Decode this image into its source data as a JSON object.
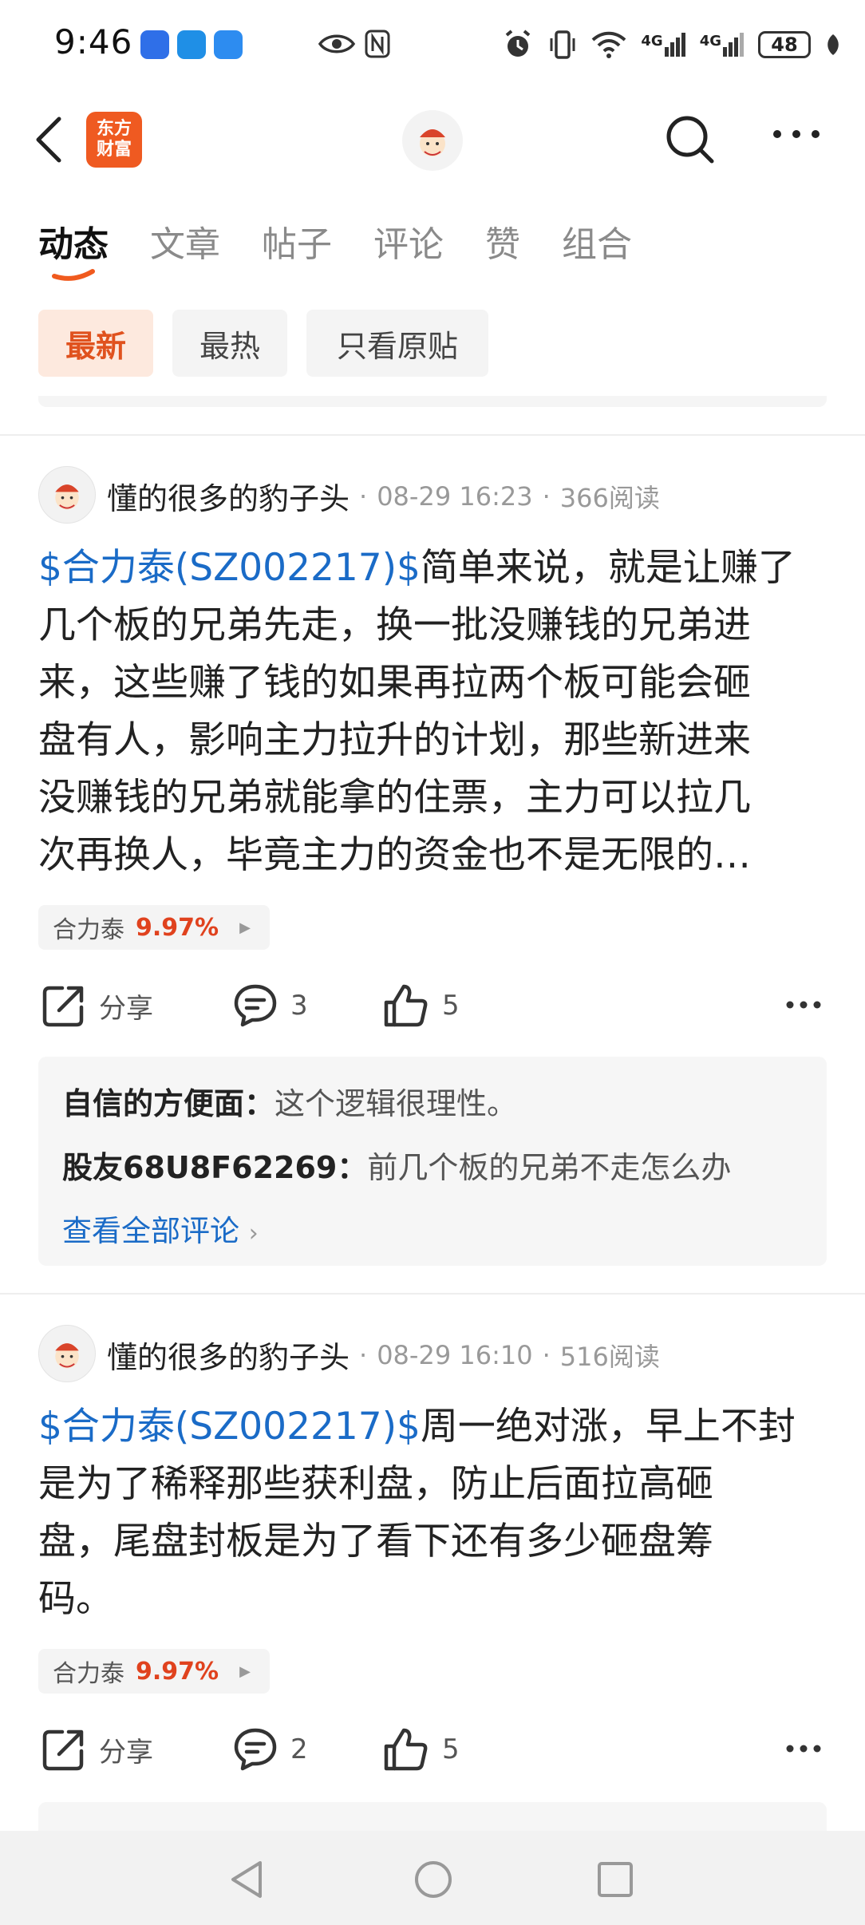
{
  "status_bar": {
    "time": "9:46",
    "signal_1": "4G",
    "signal_2": "4G",
    "battery": "48"
  },
  "header": {
    "logo_text": "东方财富"
  },
  "tabs": [
    {
      "label": "动态",
      "active": true
    },
    {
      "label": "文章",
      "active": false
    },
    {
      "label": "帖子",
      "active": false
    },
    {
      "label": "评论",
      "active": false
    },
    {
      "label": "赞",
      "active": false
    },
    {
      "label": "组合",
      "active": false
    }
  ],
  "filters": [
    {
      "label": "最新",
      "active": true
    },
    {
      "label": "最热",
      "active": false
    },
    {
      "label": "只看原贴",
      "active": false
    }
  ],
  "posts": [
    {
      "author": "懂的很多的豹子头",
      "time": "08-29 16:23",
      "reads": "366阅读",
      "stock_link": "$合力泰(SZ002217)$",
      "body_lines": [
        "简单来说，就是让赚了",
        "几个板的兄弟先走，换一批没赚钱的兄弟进",
        "来，这些赚了钱的如果再拉两个板可能会砸",
        "盘有人，影响主力拉升的计划，那些新进来",
        "没赚钱的兄弟就能拿的住票，主力可以拉几",
        "次再换人，毕竟主力的资金也不是无限的…"
      ],
      "tag_name": "合力泰",
      "tag_change": "9.97%",
      "share_label": "分享",
      "comment_count": "3",
      "like_count": "5",
      "comments": [
        {
          "user": "自信的方便面：",
          "text": "这个逻辑很理性。"
        },
        {
          "user": "股友68U8F62269：",
          "text": "前几个板的兄弟不走怎么办"
        }
      ],
      "view_all": "查看全部评论"
    },
    {
      "author": "懂的很多的豹子头",
      "time": "08-29 16:10",
      "reads": "516阅读",
      "stock_link": "$合力泰(SZ002217)$",
      "body_lines": [
        "周一绝对涨，早上不封",
        "是为了稀释那些获利盘，防止后面拉高砸",
        "盘，尾盘封板是为了看下还有多少砸盘筹",
        "码。"
      ],
      "tag_name": "合力泰",
      "tag_change": "9.97%",
      "share_label": "分享",
      "comment_count": "2",
      "like_count": "5"
    }
  ],
  "colors": {
    "accent": "#e0521e",
    "link": "#1a6bc7",
    "rise": "#e0421e"
  }
}
